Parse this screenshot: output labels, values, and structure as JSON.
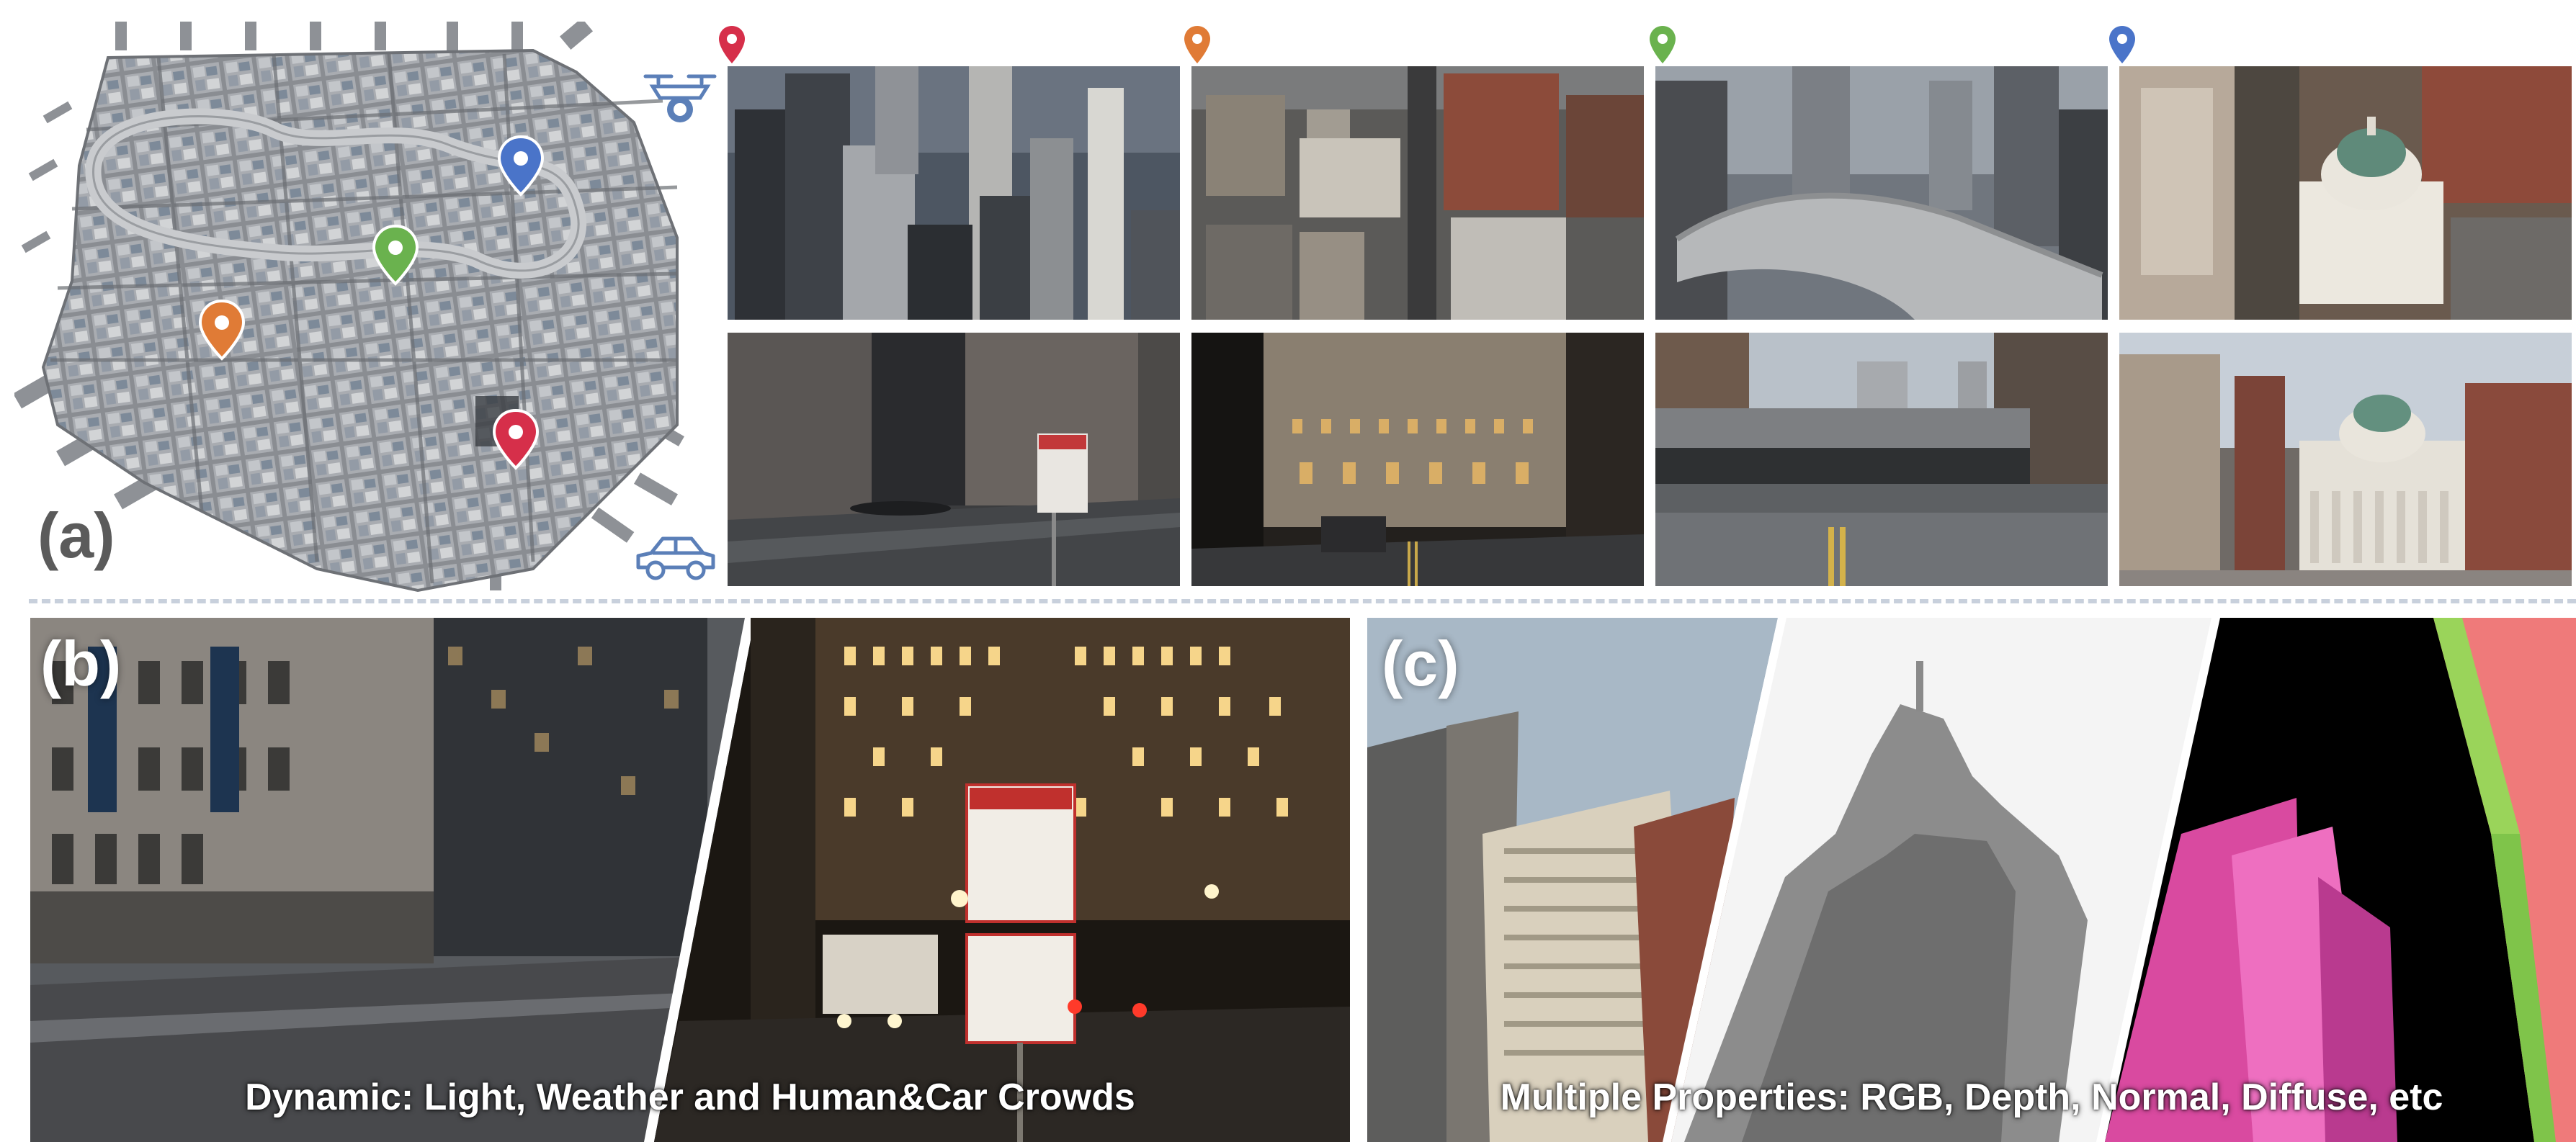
{
  "panel_a": {
    "label": "(a)",
    "map": {
      "alt_description_hidden": ""
    },
    "pins": [
      {
        "name": "red",
        "color": "#d62f4a"
      },
      {
        "name": "orange",
        "color": "#e07b36"
      },
      {
        "name": "green",
        "color": "#6ab24e"
      },
      {
        "name": "blue",
        "color": "#4a74c9"
      }
    ],
    "icons": {
      "drone": "drone-icon",
      "car": "car-icon"
    },
    "icon_color": "#5b7fb8"
  },
  "panel_b": {
    "label": "(b)",
    "caption": "Dynamic: Light, Weather and Human&Car Crowds"
  },
  "panel_c": {
    "label": "(c)",
    "caption": "Multiple Properties: RGB, Depth, Normal, Diffuse, etc"
  },
  "divider_color": "#c8d0dc"
}
